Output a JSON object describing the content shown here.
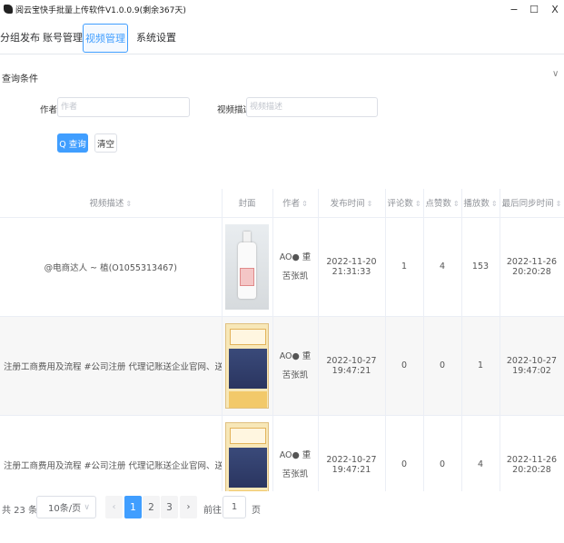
{
  "window": {
    "title": "阅云宝快手批量上传软件V1.0.0.9(剩余367天)",
    "minimize": "−",
    "maximize": "☐",
    "close": "X"
  },
  "tabs": [
    {
      "label": "分组发布",
      "active": false
    },
    {
      "label": "账号管理",
      "active": false
    },
    {
      "label": "视频管理",
      "active": true
    },
    {
      "label": "系统设置",
      "active": false
    }
  ],
  "query": {
    "title": "查询条件",
    "collapse_icon": "∨",
    "author_label": "作者",
    "author_placeholder": "作者",
    "author_value": "",
    "desc_label": "视频描述",
    "desc_placeholder": "视频描述",
    "desc_value": "",
    "search_label": "Q 查询",
    "clear_label": "清空"
  },
  "table": {
    "sort_icon": "⇕",
    "columns": [
      "视频描述",
      "封面",
      "作者",
      "发布时间",
      "评论数",
      "点赞数",
      "播放数",
      "最后同步时间"
    ],
    "rows": [
      {
        "desc": "@电商达人 ~ 植(O1055313467)",
        "cover": "bottle",
        "author": "AO● 重苦张凯",
        "publish_time": "2022-11-20 21:31:33",
        "comments": "1",
        "likes": "4",
        "plays": "153",
        "sync_time": "2022-11-26 20:20:28"
      },
      {
        "desc": "注册工商费用及流程 #公司注册 代理记账送企业官网、送企业邮箱",
        "cover": "poster",
        "author": "AO● 重苦张凯",
        "publish_time": "2022-10-27 19:47:21",
        "comments": "0",
        "likes": "0",
        "plays": "1",
        "sync_time": "2022-10-27 19:47:02"
      },
      {
        "desc": "注册工商费用及流程 #公司注册 代理记账送企业官网、送企业邮箱",
        "cover": "poster",
        "author": "AO● 重苦张凯",
        "publish_time": "2022-10-27 19:47:21",
        "comments": "0",
        "likes": "0",
        "plays": "4",
        "sync_time": "2022-11-26 20:20:28"
      }
    ]
  },
  "pagination": {
    "total": "共 23 条",
    "page_size": "10条/页",
    "page_size_icon": "∨",
    "prev_icon": "‹",
    "pages": [
      "1",
      "2",
      "3"
    ],
    "current_page": "1",
    "next_icon": "›",
    "goto_label": "前往",
    "goto_value": "1",
    "page_suffix": "页"
  },
  "colors": {
    "accent": "#409eff",
    "row_alt_bg": "#f7f7f7",
    "border": "#ebeef5"
  }
}
